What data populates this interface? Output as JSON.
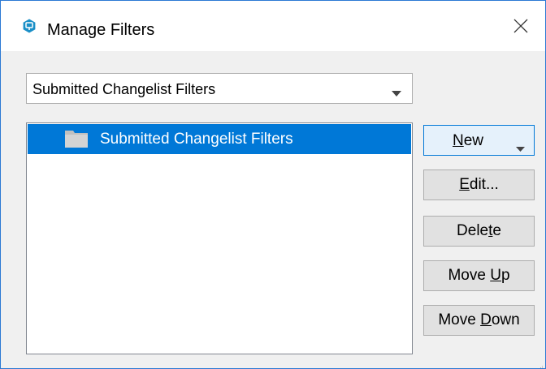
{
  "window": {
    "title": "Manage Filters",
    "icon": "p4-app-icon",
    "accent_color": "#0078d7"
  },
  "filter_type_combo": {
    "selected": "Submitted Changelist Filters"
  },
  "filter_tree": {
    "items": [
      {
        "label": "Submitted Changelist Filters",
        "icon": "folder-icon",
        "selected": true
      }
    ]
  },
  "buttons": {
    "new": {
      "pre": "",
      "mnemonic": "N",
      "post": "ew"
    },
    "edit": {
      "pre": "",
      "mnemonic": "E",
      "post": "dit..."
    },
    "delete": {
      "pre": "Dele",
      "mnemonic": "t",
      "post": "e"
    },
    "move_up": {
      "pre": "Move ",
      "mnemonic": "U",
      "post": "p"
    },
    "move_down": {
      "pre": "Move ",
      "mnemonic": "D",
      "post": "own"
    }
  }
}
